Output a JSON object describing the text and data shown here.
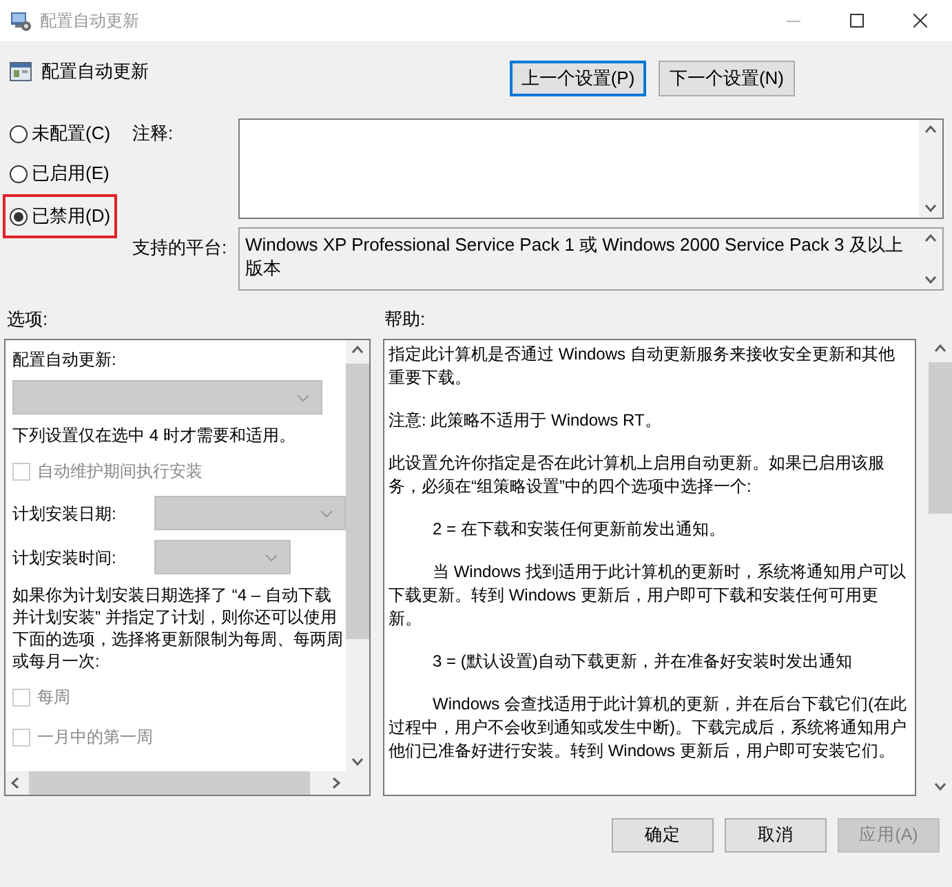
{
  "window": {
    "title": "配置自动更新"
  },
  "header": {
    "title": "配置自动更新"
  },
  "nav_buttons": [
    {
      "label": "上一个设置(P)",
      "focused": true
    },
    {
      "label": "下一个设置(N)",
      "focused": false
    }
  ],
  "state_options": [
    {
      "label": "未配置(C)",
      "selected": false,
      "highlighted": false
    },
    {
      "label": "已启用(E)",
      "selected": false,
      "highlighted": false
    },
    {
      "label": "已禁用(D)",
      "selected": true,
      "highlighted": true
    }
  ],
  "comment": {
    "label": "注释:"
  },
  "platform": {
    "label": "支持的平台:",
    "value": "Windows XP Professional Service Pack 1 或 Windows 2000 Service Pack 3 及以上版本"
  },
  "options": {
    "label": "选项:",
    "items": [
      {
        "kind": "text",
        "text": "配置自动更新:"
      },
      {
        "kind": "dropdown",
        "disabled": true
      },
      {
        "kind": "text",
        "text": "下列设置仅在选中 4 时才需要和适用。"
      },
      {
        "kind": "checkbox",
        "label": "自动维护期间执行安装",
        "checked": false,
        "disabled": true
      },
      {
        "kind": "wide_dropdown",
        "label": "计划安装日期:",
        "disabled": true
      },
      {
        "kind": "narrow_dropdown",
        "label": "计划安装时间:",
        "disabled": true
      },
      {
        "kind": "text",
        "text": "如果你为计划安装日期选择了 “4 – 自动下载并计划安装” 并指定了计划，则你还可以使用下面的选项，选择将更新限制为每周、每两周或每月一次:"
      },
      {
        "kind": "checkbox",
        "label": "每周",
        "checked": false,
        "disabled": true
      },
      {
        "kind": "checkbox",
        "label": "一月中的第一周",
        "checked": false,
        "disabled": true
      }
    ]
  },
  "help": {
    "label": "帮助:",
    "paragraphs": [
      {
        "text": "指定此计算机是否通过 Windows 自动更新服务来接收安全更新和其他重要下载。",
        "indent": false
      },
      {
        "text": "注意: 此策略不适用于 Windows RT。",
        "indent": false
      },
      {
        "text": "此设置允许你指定是否在此计算机上启用自动更新。如果已启用该服务，必须在“组策略设置”中的四个选项中选择一个:",
        "indent": false
      },
      {
        "text": "2 = 在下载和安装任何更新前发出通知。",
        "indent": true
      },
      {
        "text": "当 Windows 找到适用于此计算机的更新时，系统将通知用户可以下载更新。转到 Windows 更新后，用户即可下载和安装任何可用更新。",
        "indent": true
      },
      {
        "text": "3 = (默认设置)自动下载更新，并在准备好安装时发出通知",
        "indent": true
      },
      {
        "text": "Windows 会查找适用于此计算机的更新，并在后台下载它们(在此过程中，用户不会收到通知或发生中断)。下载完成后，系统将通知用户他们已准备好进行安装。转到 Windows 更新后，用户即可安装它们。",
        "indent": true
      }
    ]
  },
  "footer_buttons": [
    {
      "label": "确定",
      "disabled": false
    },
    {
      "label": "取消",
      "disabled": false
    },
    {
      "label": "应用(A)",
      "disabled": true
    }
  ]
}
